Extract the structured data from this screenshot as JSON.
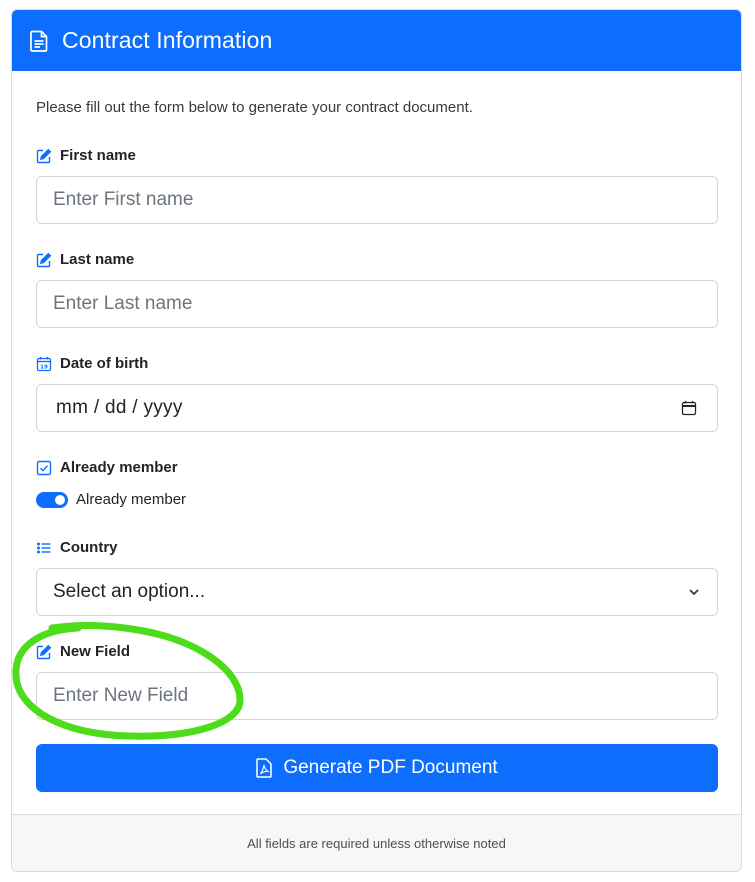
{
  "header": {
    "title": "Contract Information",
    "icon": "document-icon"
  },
  "intro_text": "Please fill out the form below to generate your contract document.",
  "fields": {
    "first_name": {
      "label": "First name",
      "icon": "pencil-square-icon",
      "placeholder": "Enter First name",
      "value": ""
    },
    "last_name": {
      "label": "Last name",
      "icon": "pencil-square-icon",
      "placeholder": "Enter Last name",
      "value": ""
    },
    "date_of_birth": {
      "label": "Date of birth",
      "icon": "calendar-icon",
      "display": "mm / dd / yyyy"
    },
    "already_member": {
      "label": "Already member",
      "icon": "check-square-icon",
      "toggle_label": "Already member",
      "checked": true
    },
    "country": {
      "label": "Country",
      "icon": "list-icon",
      "selected": "Select an option..."
    },
    "new_field": {
      "label": "New Field",
      "icon": "pencil-square-icon",
      "placeholder": "Enter New Field",
      "value": ""
    }
  },
  "submit": {
    "label": "Generate PDF Document",
    "icon": "file-pdf-icon"
  },
  "footer_text": "All fields are required unless otherwise noted",
  "colors": {
    "primary": "#0d6efd",
    "annotation": "#4ddc1a",
    "border": "#ced4da",
    "footer_bg": "#f7f7f7"
  }
}
